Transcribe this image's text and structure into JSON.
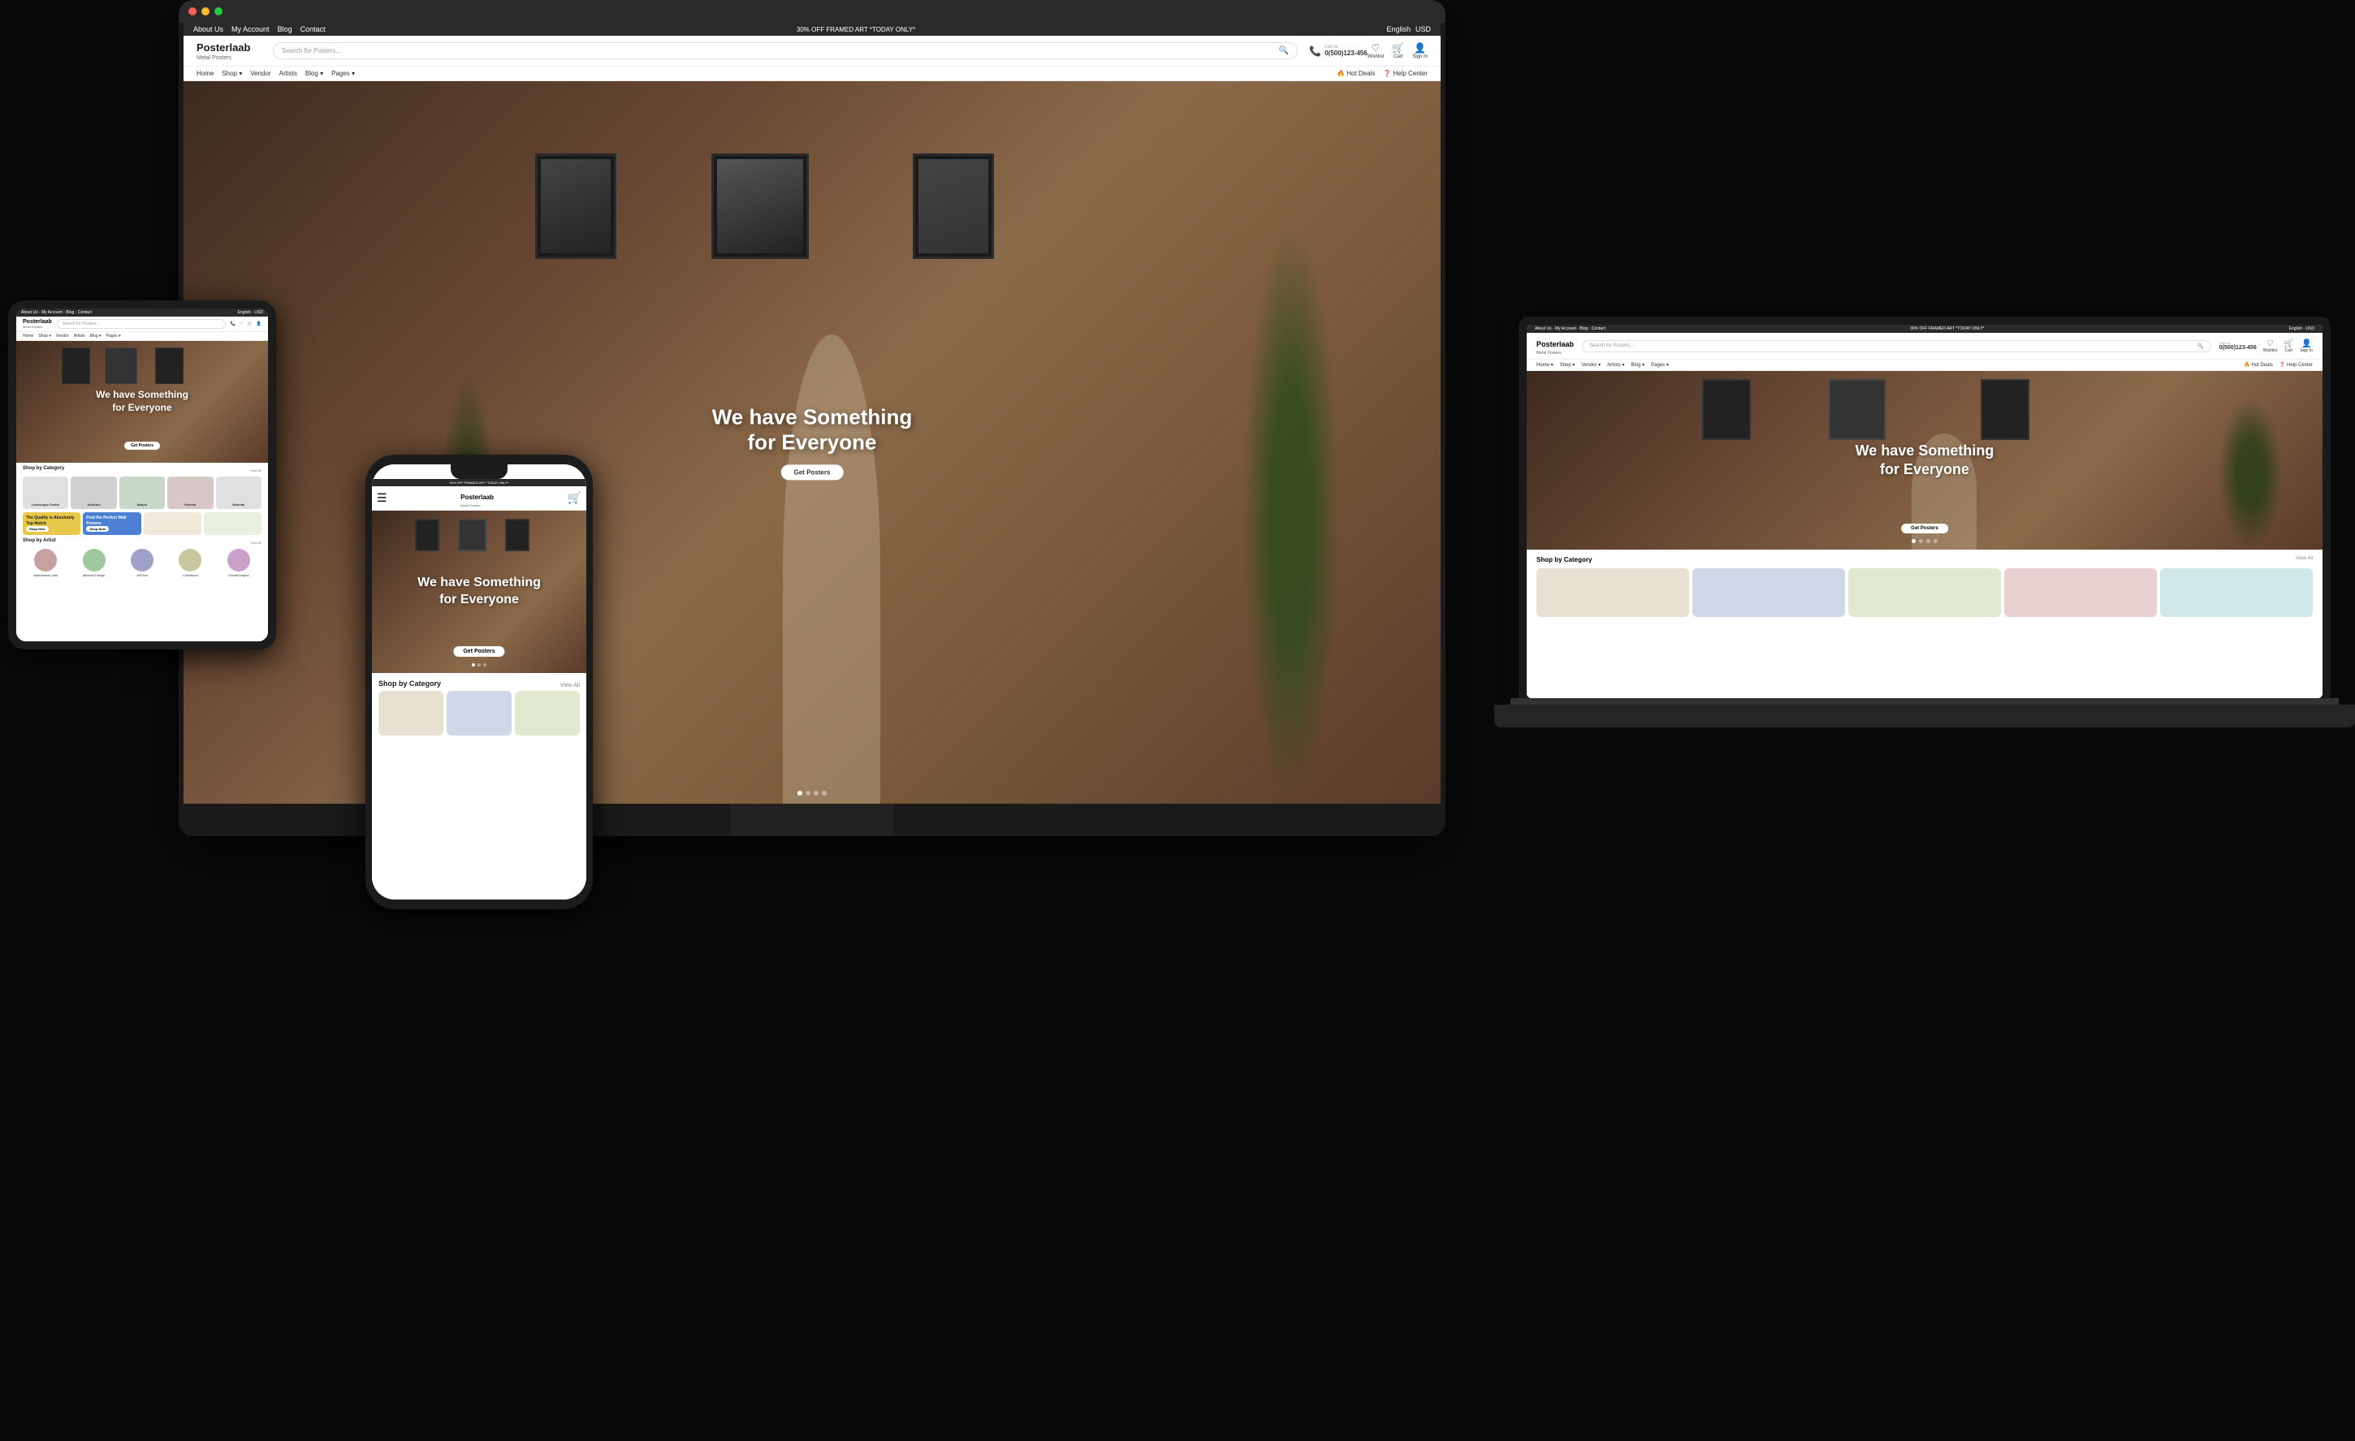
{
  "brand": {
    "name": "Posterlaab",
    "tagline": "Metal Posters",
    "logo_text": "Posterlaab",
    "logo_sub": "Metal Posters"
  },
  "topbar": {
    "links": [
      "About Us",
      "My Account",
      "Blog",
      "Contact"
    ],
    "promo": "30% OFF FRAMED ART *TODAY ONLY*",
    "language": "English",
    "currency": "USD"
  },
  "header": {
    "search_placeholder": "Search for Posters...",
    "phone_label": "Call Us:",
    "phone_number": "0(500)123-456",
    "wishlist_label": "Wishlist",
    "cart_label": "Cart",
    "signin_label": "Sign In"
  },
  "nav": {
    "items": [
      "Home",
      "Shop",
      "Vendor",
      "Artists",
      "Blog",
      "Pages"
    ],
    "right_items": [
      "Hot Deals",
      "Help Center"
    ]
  },
  "hero": {
    "title_line1": "We have Something",
    "title_line2": "for Everyone",
    "cta_button": "Get Posters",
    "dots": [
      1,
      2,
      3,
      4
    ]
  },
  "shop_section": {
    "title": "Shop by Category",
    "view_all": "View All",
    "categories": [
      {
        "label": "Landscape Poster",
        "color": "#e8e8e8"
      },
      {
        "label": "Abstract",
        "color": "#d0d0d0"
      },
      {
        "label": "Nature",
        "color": "#c8c8c8"
      },
      {
        "label": "Portrait",
        "color": "#d8d8d8"
      },
      {
        "label": "Minimal",
        "color": "#e0e0e0"
      }
    ]
  },
  "promo_section": {
    "banner1": {
      "bg": "#e8c84a",
      "text": "The Quality is Absolutely Top-Notch",
      "btn_label": "Shop Now"
    },
    "banner2": {
      "bg": "#4a7fd4",
      "text": "Find the Perfect Wall Posters",
      "btn_label": "Shop Now"
    }
  },
  "artists_section": {
    "title": "Shop by Artist",
    "view_all": "View All",
    "artists": [
      {
        "name": "Wanderlust.Labs",
        "color": "#c8a0a0"
      },
      {
        "name": "Minimal Design",
        "color": "#a0c8a0"
      },
      {
        "name": "ArtFlow",
        "color": "#a0a0c8"
      },
      {
        "name": "ColorBurst",
        "color": "#c8c8a0"
      },
      {
        "name": "DreamScapes",
        "color": "#c8a0c8"
      }
    ]
  }
}
